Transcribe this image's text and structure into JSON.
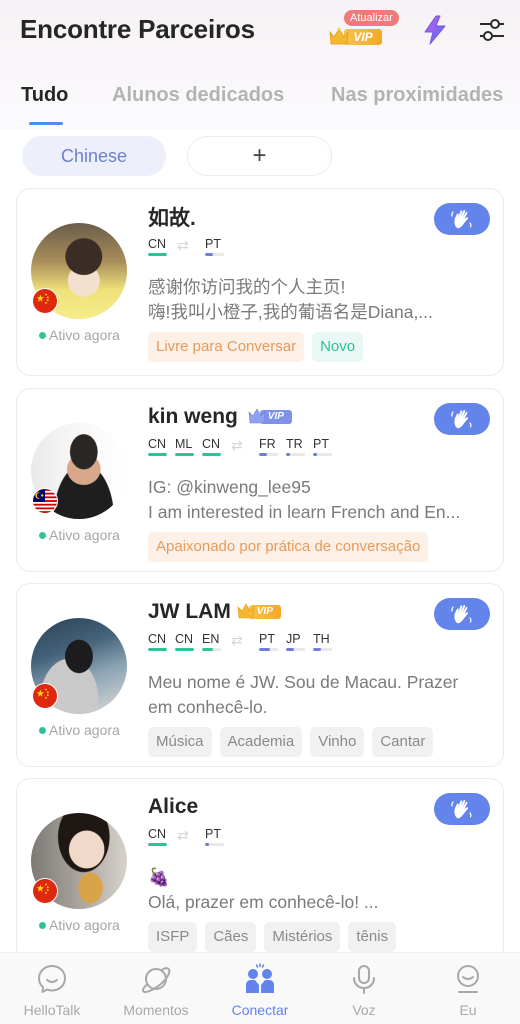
{
  "header": {
    "title": "Encontre Parceiros",
    "upgrade_badge": "Atualizar",
    "vip_label": "VIP"
  },
  "tabs": [
    {
      "label": "Tudo",
      "active": true
    },
    {
      "label": "Alunos dedicados",
      "active": false
    },
    {
      "label": "Nas proximidades",
      "active": false
    }
  ],
  "chips": {
    "language": "Chinese",
    "add": "+"
  },
  "colors": {
    "accent": "#6384ea",
    "native_bar": "#2cc39a",
    "learning_bar": "#6a7fd8",
    "online": "#2cc39a"
  },
  "cards": [
    {
      "name": "如故.",
      "vip": null,
      "flag": "china",
      "status": "Ativo agora",
      "native": [
        {
          "code": "CN",
          "level": 1.0
        }
      ],
      "learning": [
        {
          "code": "PT",
          "level": 0.4
        }
      ],
      "bio": [
        "感谢你访问我的个人主页!",
        "嗨!我叫小橙子,我的葡语名是Diana,..."
      ],
      "tags": [
        {
          "label": "Livre para Conversar",
          "style": "orange"
        },
        {
          "label": "Novo",
          "style": "green"
        }
      ]
    },
    {
      "name": "kin weng",
      "vip": "blue",
      "vip_label": "VIP",
      "flag": "malaysia",
      "status": "Ativo agora",
      "native": [
        {
          "code": "CN",
          "level": 1.0
        },
        {
          "code": "ML",
          "level": 1.0
        },
        {
          "code": "CN",
          "level": 1.0
        }
      ],
      "learning": [
        {
          "code": "FR",
          "level": 0.4
        },
        {
          "code": "TR",
          "level": 0.2
        },
        {
          "code": "PT",
          "level": 0.2
        }
      ],
      "bio": [
        "IG: @kinweng_lee95",
        "I am interested in learn French and En..."
      ],
      "tags": [
        {
          "label": "Apaixonado por prática de conversação",
          "style": "orange"
        }
      ]
    },
    {
      "name": "JW LAM",
      "vip": "gold",
      "vip_label": "VIP",
      "flag": "china",
      "status": "Ativo agora",
      "native": [
        {
          "code": "CN",
          "level": 1.0
        },
        {
          "code": "CN",
          "level": 1.0
        },
        {
          "code": "EN",
          "level": 0.6
        }
      ],
      "learning": [
        {
          "code": "PT",
          "level": 0.6
        },
        {
          "code": "JP",
          "level": 0.4
        },
        {
          "code": "TH",
          "level": 0.4
        }
      ],
      "bio": [
        "Meu nome é JW. Sou de Macau. Prazer",
        "em conhecê-lo."
      ],
      "tags": [
        {
          "label": "Música",
          "style": "gray"
        },
        {
          "label": "Academia",
          "style": "gray"
        },
        {
          "label": "Vinho",
          "style": "gray"
        },
        {
          "label": "Cantar",
          "style": "gray"
        }
      ]
    },
    {
      "name": "Alice",
      "vip": null,
      "flag": "china",
      "status": "Ativo agora",
      "native": [
        {
          "code": "CN",
          "level": 1.0
        }
      ],
      "learning": [
        {
          "code": "PT",
          "level": 0.2
        }
      ],
      "bio": [
        "🍇",
        "Olá, prazer em conhecê-lo! ..."
      ],
      "tags": [
        {
          "label": "ISFP",
          "style": "gray"
        },
        {
          "label": "Cães",
          "style": "gray"
        },
        {
          "label": "Mistérios",
          "style": "gray"
        },
        {
          "label": "tênis",
          "style": "gray"
        }
      ]
    }
  ],
  "bottom_nav": [
    {
      "label": "HelloTalk",
      "icon": "chat-bubble-icon",
      "active": false
    },
    {
      "label": "Momentos",
      "icon": "planet-icon",
      "active": false
    },
    {
      "label": "Conectar",
      "icon": "connect-people-icon",
      "active": true
    },
    {
      "label": "Voz",
      "icon": "microphone-icon",
      "active": false
    },
    {
      "label": "Eu",
      "icon": "profile-icon",
      "active": false
    }
  ]
}
